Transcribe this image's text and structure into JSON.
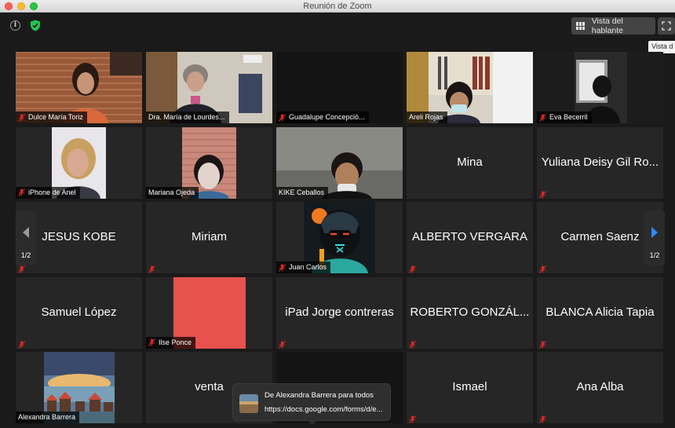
{
  "window": {
    "title": "Reunión de Zoom"
  },
  "topbar": {
    "info_icon": "info-icon",
    "security_icon": "shield-check-icon",
    "speaker_view_label": "Vista del hablante",
    "tooltip": "Vista d"
  },
  "pager": {
    "left_count": "1/2",
    "right_count": "1/2"
  },
  "participants": [
    {
      "name": "Dulce María Toriz",
      "video": true,
      "muted": true
    },
    {
      "name": "Dra. María de Lourdes...",
      "video": true,
      "muted": false
    },
    {
      "name": "Guadalupe Concepció...",
      "video": false,
      "muted": true
    },
    {
      "name": "Areli Rojas",
      "video": true,
      "muted": false
    },
    {
      "name": "Eva Becerril",
      "video": true,
      "muted": true
    },
    {
      "name": "iPhone de Anel",
      "video": true,
      "muted": true
    },
    {
      "name": "Mariana Ojeda",
      "video": true,
      "muted": false
    },
    {
      "name": "KIKE Ceballos",
      "video": true,
      "muted": false
    },
    {
      "name": "Mina",
      "video": false,
      "muted": false
    },
    {
      "name": "Yuliana Deisy Gil Ro...",
      "video": false,
      "muted": true
    },
    {
      "name": "JESUS KOBE",
      "video": false,
      "muted": true
    },
    {
      "name": "Miriam",
      "video": false,
      "muted": true
    },
    {
      "name": "Juan Carlos",
      "video": true,
      "muted": true
    },
    {
      "name": "ALBERTO VERGARA",
      "video": false,
      "muted": true
    },
    {
      "name": "Carmen Saenz",
      "video": false,
      "muted": true
    },
    {
      "name": "Samuel López",
      "video": false,
      "muted": true
    },
    {
      "name": "Ilse Ponce",
      "video": true,
      "muted": true
    },
    {
      "name": "iPad Jorge contreras",
      "video": false,
      "muted": true
    },
    {
      "name": "ROBERTO GONZÁL...",
      "video": false,
      "muted": true
    },
    {
      "name": "BLANCA Alicia Tapia",
      "video": false,
      "muted": true
    },
    {
      "name": "Alexandra Barrera",
      "video": true,
      "muted": false
    },
    {
      "name": "venta",
      "video": false,
      "muted": false
    },
    {
      "name": "",
      "video": false,
      "muted": false
    },
    {
      "name": "Ismael",
      "video": false,
      "muted": true
    },
    {
      "name": "Ana Alba",
      "video": false,
      "muted": true
    }
  ],
  "chat_toast": {
    "title": "De Alexandra Barrera para todos",
    "message": "https://docs.google.com/forms/d/e..."
  }
}
